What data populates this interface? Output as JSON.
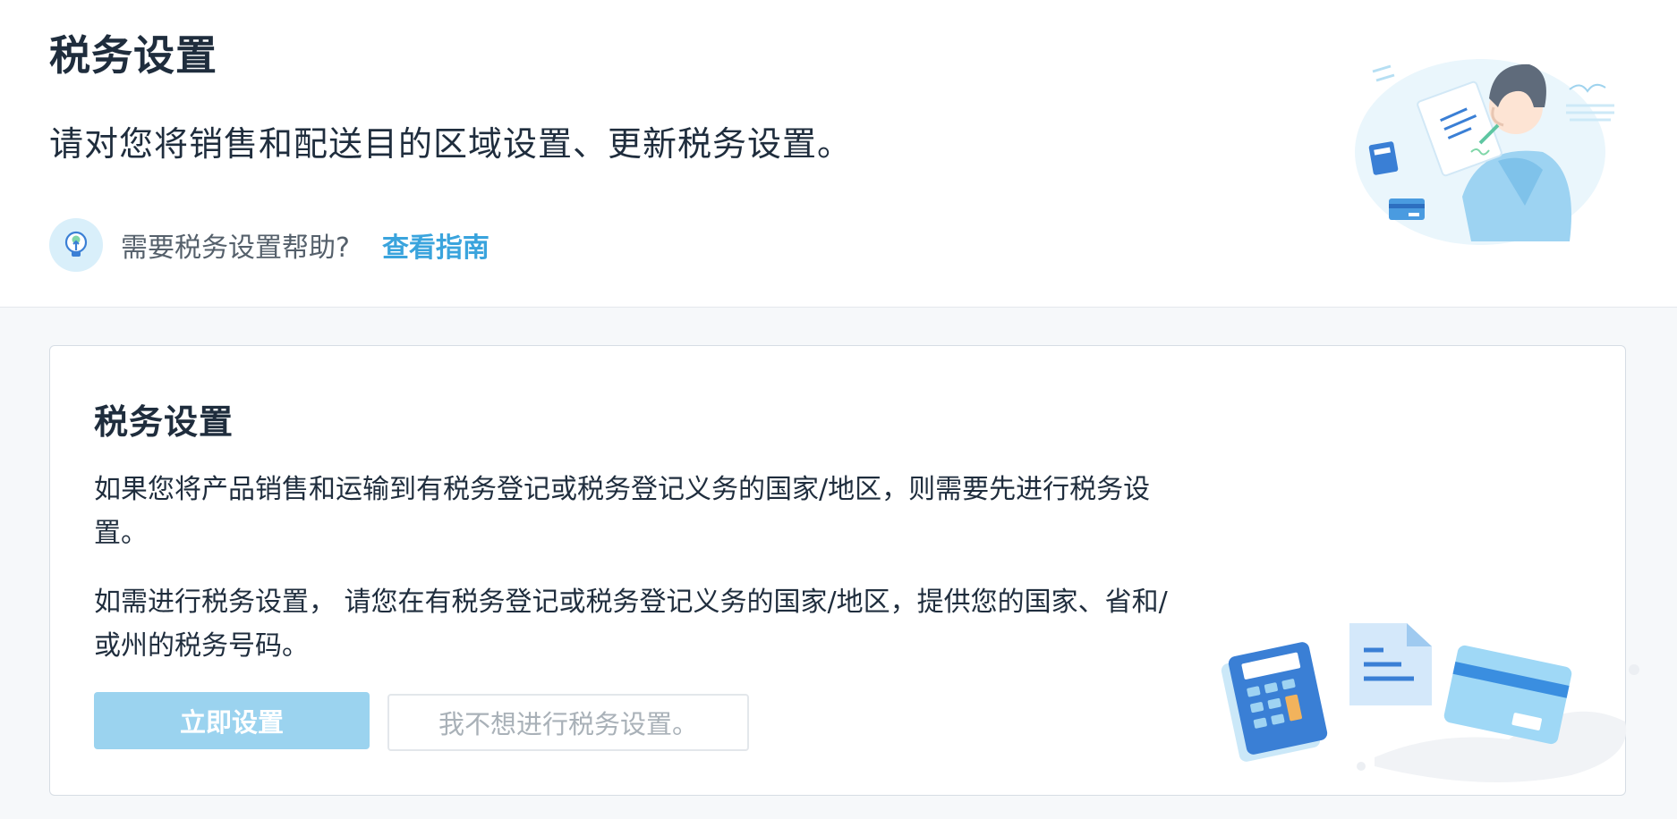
{
  "header": {
    "title": "税务设置",
    "subtitle": "请对您将销售和配送目的区域设置、更新税务设置。",
    "help_text": "需要税务设置帮助?",
    "help_link": "查看指南"
  },
  "card": {
    "title": "税务设置",
    "paragraph1": "如果您将产品销售和运输到有税务登记或税务登记义务的国家/地区，则需要先进行税务设置。",
    "paragraph2": "如需进行税务设置， 请您在有税务登记或税务登记义务的国家/地区，提供您的国家、省和/或州的税务号码。",
    "primary_button": "立即设置",
    "secondary_button": "我不想进行税务设置。"
  },
  "icons": {
    "help": "lightbulb-icon",
    "header_illustration": "person-signing-document-illustration",
    "card_illustration": "calculator-document-card-illustration"
  },
  "colors": {
    "accent": "#3aa4dd",
    "primary_button": "#9bd3ef",
    "text": "#1f2d3d",
    "muted_text": "#55606b",
    "background": "#f6f8fa"
  }
}
